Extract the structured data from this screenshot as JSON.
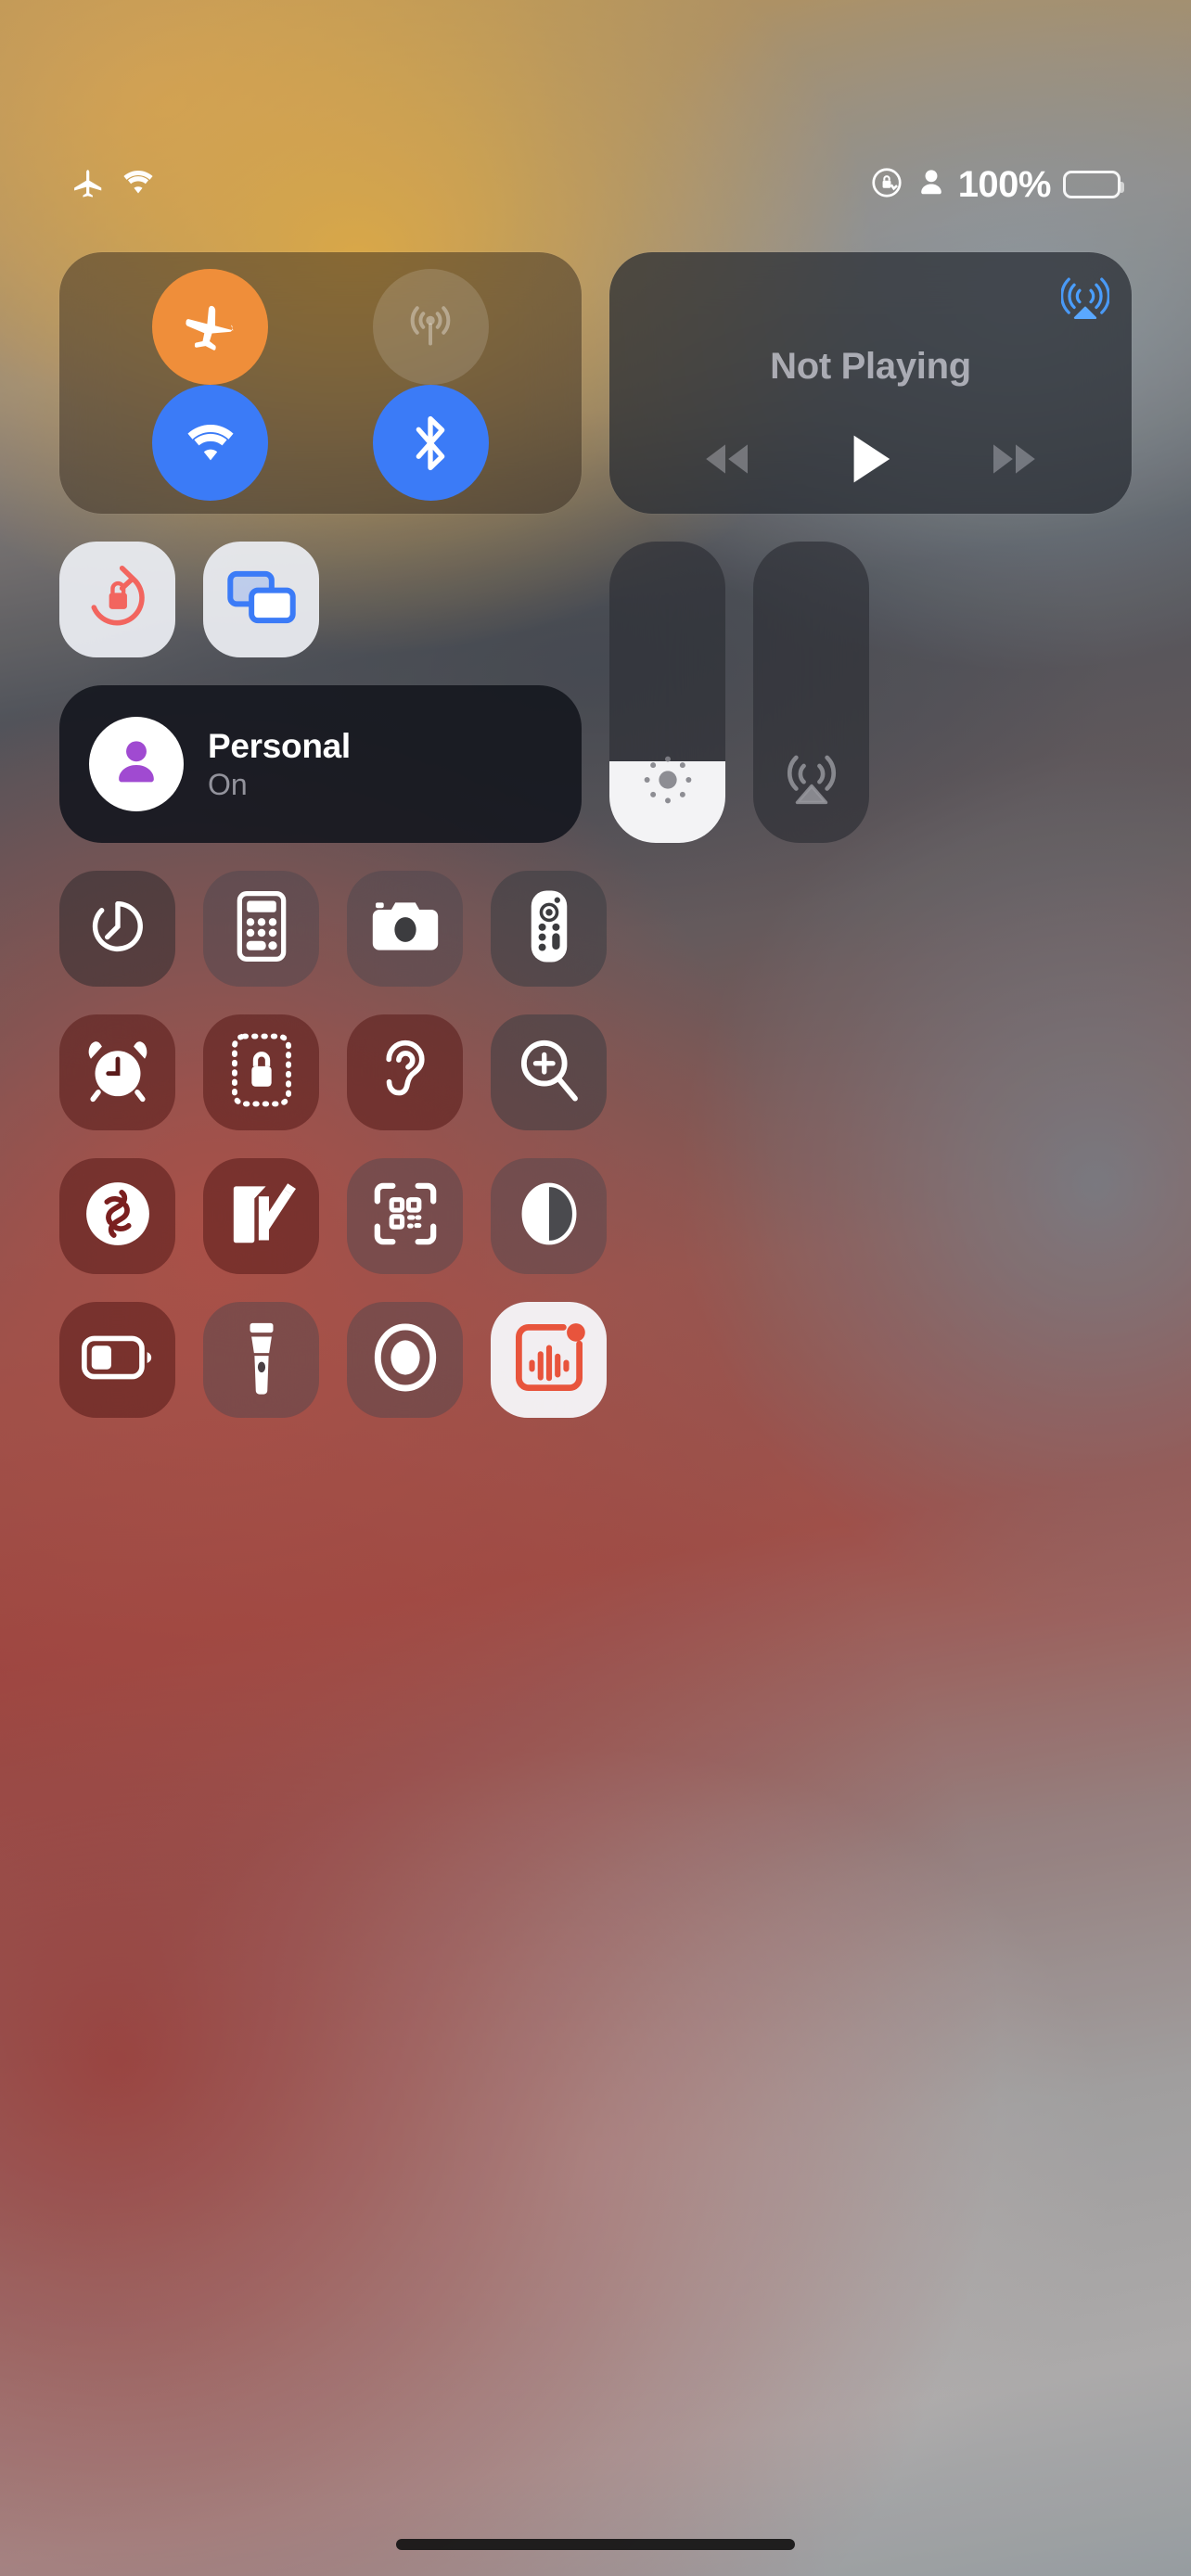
{
  "status_bar": {
    "airplane_icon": "airplane-icon",
    "wifi_icon": "wifi-icon",
    "rotation_lock_icon": "rotation-lock-icon",
    "focus_icon": "focus-person-icon",
    "battery_percent": "100%",
    "battery_level": 100
  },
  "connectivity": {
    "airplane": {
      "icon": "airplane-icon",
      "state": "on",
      "color": "#ef8e3a"
    },
    "cellular": {
      "icon": "cellular-antenna-icon",
      "state": "off",
      "color": "rgba(255,255,255,0.14)"
    },
    "wifi": {
      "icon": "wifi-icon",
      "state": "on",
      "color": "#3b7bf7"
    },
    "bluetooth": {
      "icon": "bluetooth-icon",
      "state": "on",
      "color": "#3b7bf7"
    }
  },
  "media": {
    "title": "Not Playing",
    "airplay_icon": "airplay-audio-icon",
    "airplay_color": "#4a9eff",
    "rewind_icon": "rewind-icon",
    "play_icon": "play-icon",
    "forward_icon": "fast-forward-icon"
  },
  "tiles": {
    "rotation_lock": {
      "icon": "rotation-lock-icon",
      "state": "on",
      "color": "#f2655f"
    },
    "screen_mirroring": {
      "icon": "screen-mirroring-icon",
      "state": "on",
      "color": "#3b7bf7"
    }
  },
  "focus": {
    "icon": "person-icon",
    "icon_color": "#a04ad1",
    "name": "Personal",
    "state": "On"
  },
  "sliders": {
    "brightness": {
      "icon": "brightness-sun-icon",
      "value": 27
    },
    "volume": {
      "icon": "airplay-volume-icon",
      "value": 0
    }
  },
  "apps": [
    [
      {
        "name": "timer",
        "icon": "timer-icon",
        "tint": "tint-dark",
        "active": false
      },
      {
        "name": "calculator",
        "icon": "calculator-icon",
        "tint": "",
        "active": false
      },
      {
        "name": "camera",
        "icon": "camera-icon",
        "tint": "",
        "active": false
      },
      {
        "name": "apple-tv-remote",
        "icon": "remote-icon",
        "tint": "tint-slate",
        "active": false
      }
    ],
    [
      {
        "name": "alarm",
        "icon": "alarm-clock-icon",
        "tint": "tint-red",
        "active": false
      },
      {
        "name": "guided-access",
        "icon": "guided-access-lock-icon",
        "tint": "tint-red",
        "active": false
      },
      {
        "name": "hearing",
        "icon": "ear-icon",
        "tint": "tint-red",
        "active": false
      },
      {
        "name": "magnifier",
        "icon": "magnifier-icon",
        "tint": "tint-slate",
        "active": false
      }
    ],
    [
      {
        "name": "shazam",
        "icon": "shazam-icon",
        "tint": "tint-red",
        "active": false
      },
      {
        "name": "notes",
        "icon": "notes-pencil-icon",
        "tint": "tint-red",
        "active": false
      },
      {
        "name": "qr-code-scanner",
        "icon": "qr-code-icon",
        "tint": "",
        "active": false
      },
      {
        "name": "dark-mode",
        "icon": "dark-mode-circle-icon",
        "tint": "",
        "active": false
      }
    ],
    [
      {
        "name": "low-power-mode",
        "icon": "battery-icon",
        "tint": "tint-red",
        "active": false
      },
      {
        "name": "flashlight",
        "icon": "flashlight-icon",
        "tint": "",
        "active": false
      },
      {
        "name": "screen-recording",
        "icon": "screen-record-icon",
        "tint": "",
        "active": false
      },
      {
        "name": "voice-memos",
        "icon": "voice-memos-icon",
        "tint": "",
        "active": true,
        "badge": true,
        "icon_color": "#e8543c"
      }
    ]
  ]
}
